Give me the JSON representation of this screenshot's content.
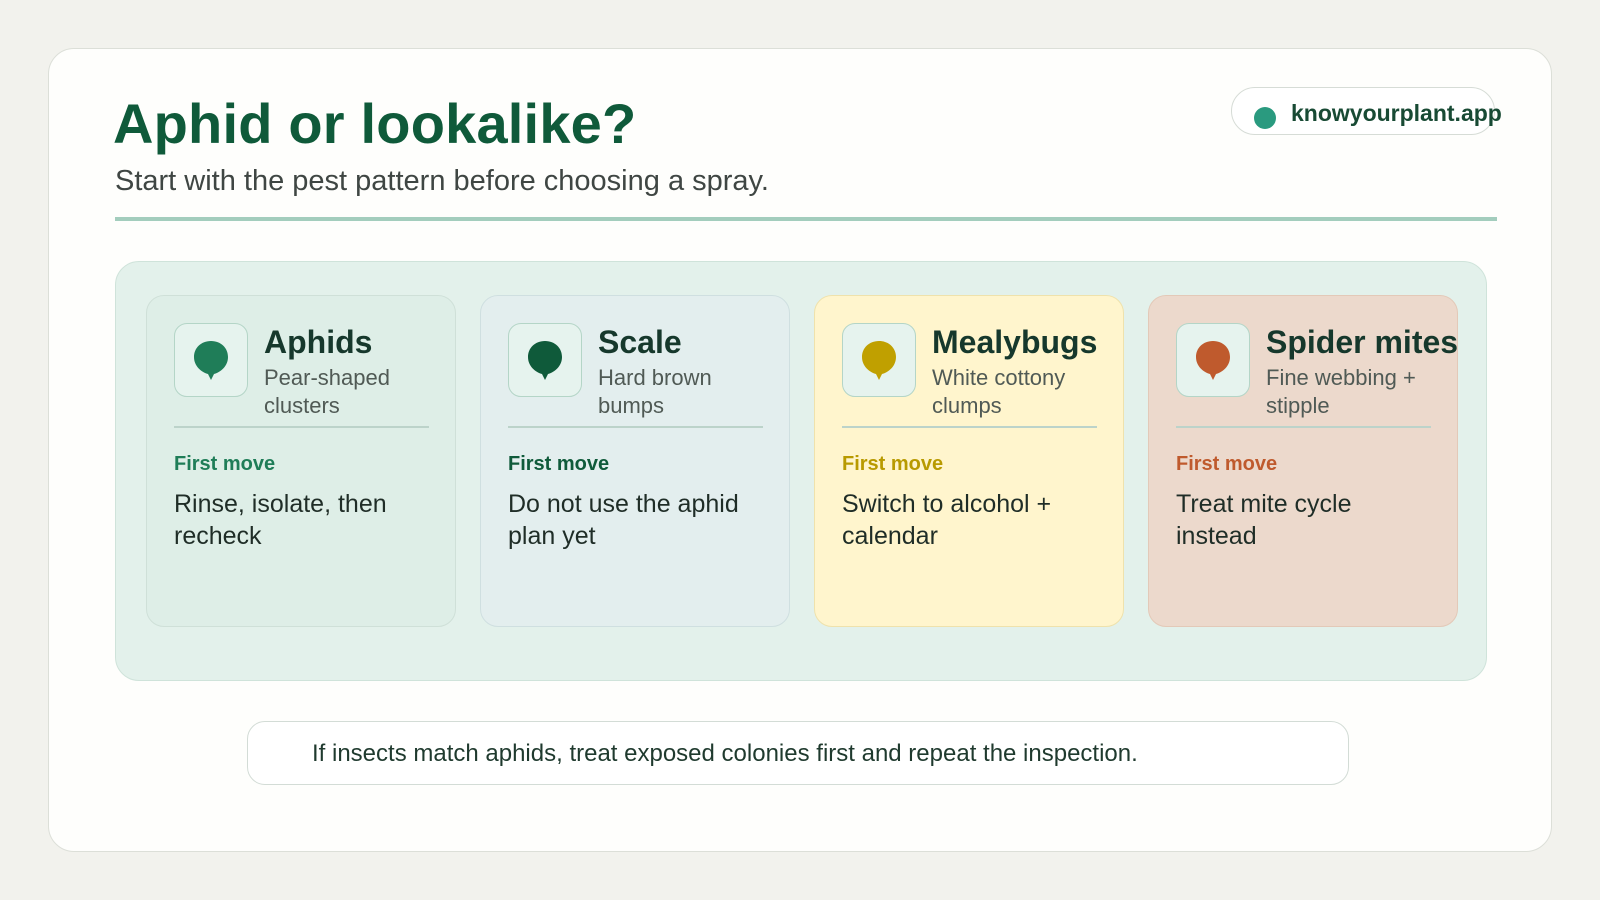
{
  "header": {
    "title": "Aphid or lookalike?",
    "subtitle": "Start with the pest pattern before choosing a spray."
  },
  "brand": {
    "label": "knowyourplant.app",
    "dot_color": "#2a9a7f"
  },
  "cards": [
    {
      "name": "Aphids",
      "hint": "Pear-shaped clusters",
      "move_label": "First move",
      "move_text": "Rinse, isolate, then recheck",
      "icon": "aphid-drop-icon",
      "accent": "#1f7d58"
    },
    {
      "name": "Scale",
      "hint": "Hard brown bumps",
      "move_label": "First move",
      "move_text": "Do not use the aphid plan yet",
      "icon": "scale-drop-icon",
      "accent": "#0f5a3a"
    },
    {
      "name": "Mealybugs",
      "hint": "White cottony clumps",
      "move_label": "First move",
      "move_text": "Switch to alcohol + calendar",
      "icon": "mealybug-drop-icon",
      "accent": "#c0a000"
    },
    {
      "name": "Spider mites",
      "hint": "Fine webbing + stipple",
      "move_label": "First move",
      "move_text": "Treat mite cycle instead",
      "icon": "spider-mite-drop-icon",
      "accent": "#bf5a2d"
    }
  ],
  "footnote": "If insects match aphids, treat exposed colonies first and repeat the inspection."
}
